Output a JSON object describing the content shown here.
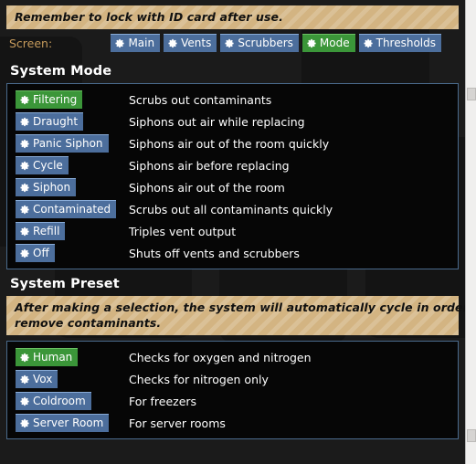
{
  "header_notice": {
    "icon": "warning-stripes",
    "lines": [
      "Remember to lock with ID card after use."
    ]
  },
  "screen_nav": {
    "label": "Screen:",
    "buttons": [
      {
        "label": "Main",
        "icon": "gear-icon",
        "active": false
      },
      {
        "label": "Vents",
        "icon": "gear-icon",
        "active": false
      },
      {
        "label": "Scrubbers",
        "icon": "gear-icon",
        "active": false
      },
      {
        "label": "Mode",
        "icon": "gear-icon",
        "active": true
      },
      {
        "label": "Thresholds",
        "icon": "gear-icon",
        "active": false
      }
    ]
  },
  "system_mode": {
    "heading": "System Mode",
    "rows": [
      {
        "label": "Filtering",
        "icon": "gear-icon",
        "active": true,
        "desc": "Scrubs out contaminants"
      },
      {
        "label": "Draught",
        "icon": "gear-icon",
        "active": false,
        "desc": "Siphons out air while replacing"
      },
      {
        "label": "Panic Siphon",
        "icon": "gear-icon",
        "active": false,
        "desc": "Siphons air out of the room quickly"
      },
      {
        "label": "Cycle",
        "icon": "gear-icon",
        "active": false,
        "desc": "Siphons air before replacing"
      },
      {
        "label": "Siphon",
        "icon": "gear-icon",
        "active": false,
        "desc": "Siphons air out of the room"
      },
      {
        "label": "Contaminated",
        "icon": "gear-icon",
        "active": false,
        "desc": "Scrubs out all contaminants quickly"
      },
      {
        "label": "Refill",
        "icon": "gear-icon",
        "active": false,
        "desc": "Triples vent output"
      },
      {
        "label": "Off",
        "icon": "gear-icon",
        "active": false,
        "desc": "Shuts off vents and scrubbers"
      }
    ]
  },
  "system_preset": {
    "heading": "System Preset",
    "notice": {
      "icon": "warning-stripes",
      "lines": [
        "After making a selection, the system will automatically cycle in order to",
        "remove contaminants."
      ]
    },
    "rows": [
      {
        "label": "Human",
        "icon": "gear-icon",
        "active": true,
        "desc": "Checks for oxygen and nitrogen"
      },
      {
        "label": "Vox",
        "icon": "gear-icon",
        "active": false,
        "desc": "Checks for nitrogen only"
      },
      {
        "label": "Coldroom",
        "icon": "gear-icon",
        "active": false,
        "desc": "For freezers"
      },
      {
        "label": "Server Room",
        "icon": "gear-icon",
        "active": false,
        "desc": "For server rooms"
      }
    ]
  },
  "colors": {
    "page_background": "#1b1b1b",
    "panel_background": "#060606",
    "panel_border": "#4a6a8c",
    "button_blue": "#4c6e9c",
    "button_blue_top": "#89acd8",
    "button_green": "#3b9639",
    "button_green_top": "#6cc265",
    "notice_tan": "#d3b482",
    "screen_label": "#c59a5b",
    "text": "#ffffff"
  }
}
